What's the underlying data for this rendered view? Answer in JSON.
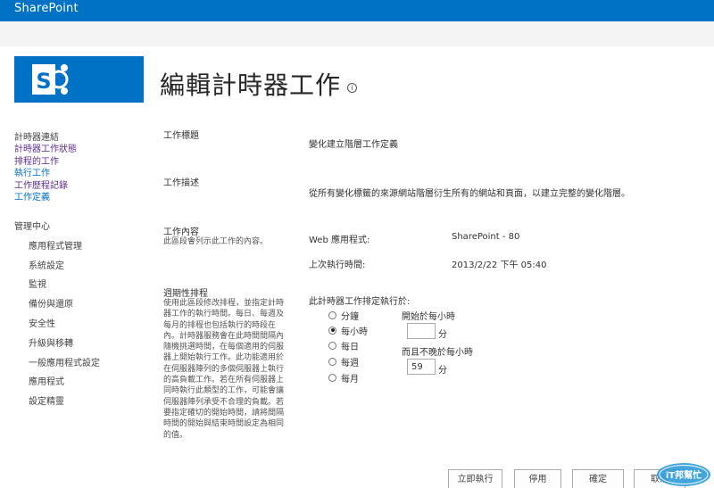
{
  "topbar": {
    "brand": "SharePoint"
  },
  "page": {
    "title": "編輯計時器工作",
    "info_icon": "i"
  },
  "leftnav": {
    "group_head": "計時器連結",
    "links": [
      {
        "label": "計時器工作狀態",
        "visited": true
      },
      {
        "label": "排程的工作",
        "visited": true
      },
      {
        "label": "執行工作",
        "visited": false
      },
      {
        "label": "工作歷程記錄",
        "visited": true
      },
      {
        "label": "工作定義",
        "visited": false
      }
    ],
    "central_admin": "管理中心",
    "sections": [
      "應用程式管理",
      "系統設定",
      "監視",
      "備份與還原",
      "安全性",
      "升級與移轉",
      "一般應用程式設定",
      "應用程式",
      "設定精靈"
    ]
  },
  "form": {
    "job_title_label": "工作標題",
    "job_title_value": "變化建立階層工作定義",
    "job_desc_label": "工作描述",
    "job_desc_value": "從所有變化標籤的來源網站階層衍生所有的網站和頁面，以建立完整的變化階層。",
    "job_props_label": "工作內容",
    "job_props_desc": "此區段會列示此工作的內容。",
    "web_app_label": "Web 應用程式:",
    "web_app_value": "SharePoint - 80",
    "last_run_label": "上次執行時間:",
    "last_run_value": "2013/2/22 下午 05:40",
    "schedule_label": "週期性排程",
    "schedule_desc": "使用此區段修改排程，並指定計時器工作的執行時間。每日、每週及每月的排程也包括執行的時段在內。計時器服務會在此時間間隔內隨機挑選時間，在每個適用的伺服器上開始執行工作。此功能適用於在伺服器陣列的多個伺服器上執行的高負載工作。若在所有伺服器上同時執行此類型的工作，可能會讓伺服器陣列承受不合理的負載。若要指定確切的開始時間，請將間隔時間的開始與結束時間設定為相同的值。",
    "schedule_prompt": "此計時器工作排定執行於:",
    "schedule_options": [
      {
        "label": "分鐘",
        "selected": false
      },
      {
        "label": "每小時",
        "selected": true
      },
      {
        "label": "每日",
        "selected": false
      },
      {
        "label": "每週",
        "selected": false
      },
      {
        "label": "每月",
        "selected": false
      }
    ],
    "start_label": "開始於每小時",
    "start_value": "",
    "start_unit": "分",
    "end_label": "而且不晚於每小時",
    "end_value": "59",
    "end_unit": "分"
  },
  "buttons": {
    "run_now": "立即執行",
    "disable": "停用",
    "ok": "確定",
    "cancel": "取消"
  },
  "watermark": {
    "text": "iT邦幫忙"
  },
  "colors": {
    "brand_blue": "#0072c6",
    "link": "#0072c6",
    "visited": "#5c2d91"
  }
}
